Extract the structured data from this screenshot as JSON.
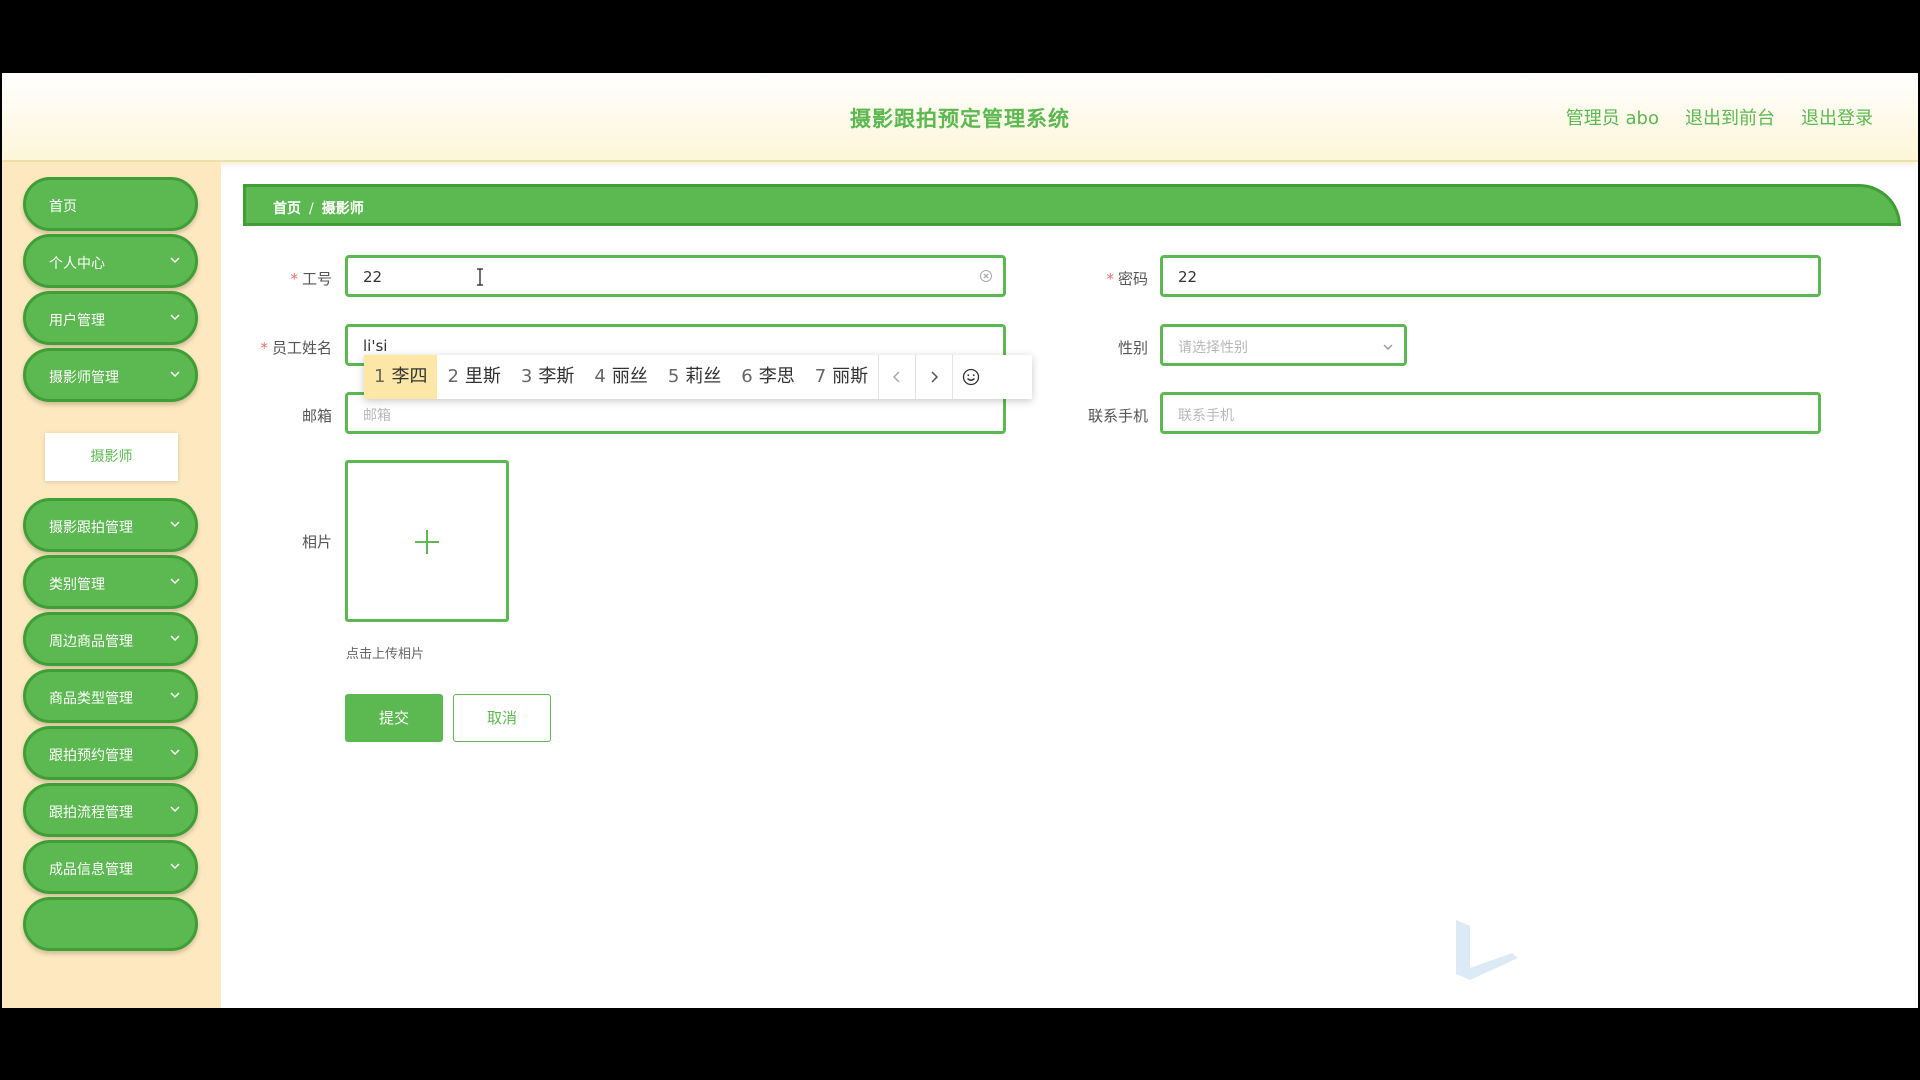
{
  "header": {
    "title": "摄影跟拍预定管理系统",
    "user_label": "管理员 abo",
    "to_front_label": "退出到前台",
    "logout_label": "退出登录"
  },
  "sidebar": {
    "items": [
      {
        "label": "首页"
      },
      {
        "label": "个人中心"
      },
      {
        "label": "用户管理"
      },
      {
        "label": "摄影师管理"
      },
      {
        "label": "摄影跟拍管理"
      },
      {
        "label": "类别管理"
      },
      {
        "label": "周边商品管理"
      },
      {
        "label": "商品类型管理"
      },
      {
        "label": "跟拍预约管理"
      },
      {
        "label": "跟拍流程管理"
      },
      {
        "label": "成品信息管理"
      }
    ],
    "submenu_label": "摄影师"
  },
  "breadcrumb": {
    "home": "首页",
    "separator": "/",
    "current": "摄影师"
  },
  "form": {
    "id_label": "工号",
    "id_value": "22",
    "password_label": "密码",
    "password_value": "22",
    "name_label": "员工姓名",
    "name_value": "li'si",
    "gender_label": "性别",
    "gender_placeholder": "请选择性别",
    "email_label": "邮箱",
    "email_placeholder": "邮箱",
    "phone_label": "联系手机",
    "phone_placeholder": "联系手机",
    "photo_label": "相片",
    "photo_hint": "点击上传相片",
    "submit_label": "提交",
    "cancel_label": "取消",
    "required_mark": "*"
  },
  "ime": {
    "candidates": [
      {
        "num": "1",
        "text": "李四"
      },
      {
        "num": "2",
        "text": "里斯"
      },
      {
        "num": "3",
        "text": "李斯"
      },
      {
        "num": "4",
        "text": "丽丝"
      },
      {
        "num": "5",
        "text": "莉丝"
      },
      {
        "num": "6",
        "text": "李思"
      },
      {
        "num": "7",
        "text": "丽斯"
      }
    ],
    "selected_index": 0
  },
  "colors": {
    "accent": "#5cb850",
    "accent_dark": "#3f9e36",
    "sidebar_bg": "#fde8bf",
    "required": "#f56c6c"
  }
}
